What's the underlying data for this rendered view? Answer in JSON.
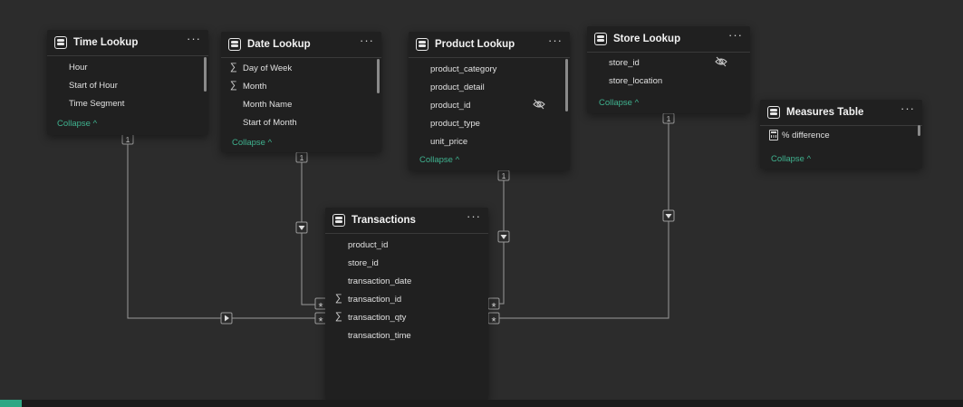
{
  "tables": {
    "time_lookup": {
      "title": "Time Lookup",
      "more": "···",
      "fields": [
        {
          "name": "Hour"
        },
        {
          "name": "Start of Hour"
        },
        {
          "name": "Time Segment"
        }
      ],
      "collapse": "Collapse ^"
    },
    "date_lookup": {
      "title": "Date Lookup",
      "more": "···",
      "fields": [
        {
          "name": "Day of Week",
          "sigma": "∑"
        },
        {
          "name": "Month",
          "sigma": "∑"
        },
        {
          "name": "Month Name"
        },
        {
          "name": "Start of Month"
        }
      ],
      "collapse": "Collapse ^"
    },
    "product_lookup": {
      "title": "Product Lookup",
      "more": "···",
      "fields": [
        {
          "name": "product_category"
        },
        {
          "name": "product_detail"
        },
        {
          "name": "product_id",
          "hidden_icon": "eye-off-icon"
        },
        {
          "name": "product_type"
        },
        {
          "name": "unit_price"
        }
      ],
      "collapse": "Collapse ^"
    },
    "store_lookup": {
      "title": "Store Lookup",
      "more": "···",
      "fields": [
        {
          "name": "store_id",
          "hidden_icon": "eye-off-icon"
        },
        {
          "name": "store_location"
        }
      ],
      "collapse": "Collapse ^"
    },
    "measures_table": {
      "title": "Measures Table",
      "more": "···",
      "fields": [
        {
          "name": "% difference",
          "icon": "calculator-icon"
        }
      ],
      "collapse": "Collapse ^"
    },
    "transactions": {
      "title": "Transactions",
      "more": "···",
      "fields": [
        {
          "name": "product_id"
        },
        {
          "name": "store_id"
        },
        {
          "name": "transaction_date"
        },
        {
          "name": "transaction_id",
          "sigma": "∑"
        },
        {
          "name": "transaction_qty",
          "sigma": "∑"
        },
        {
          "name": "transaction_time"
        }
      ]
    }
  },
  "relationships": {
    "one_label": "1",
    "many_label": "*"
  },
  "colors": {
    "canvas": "#2c2c2c",
    "card": "#202020",
    "accent": "#3fb28f",
    "line": "#9a9a9a"
  }
}
